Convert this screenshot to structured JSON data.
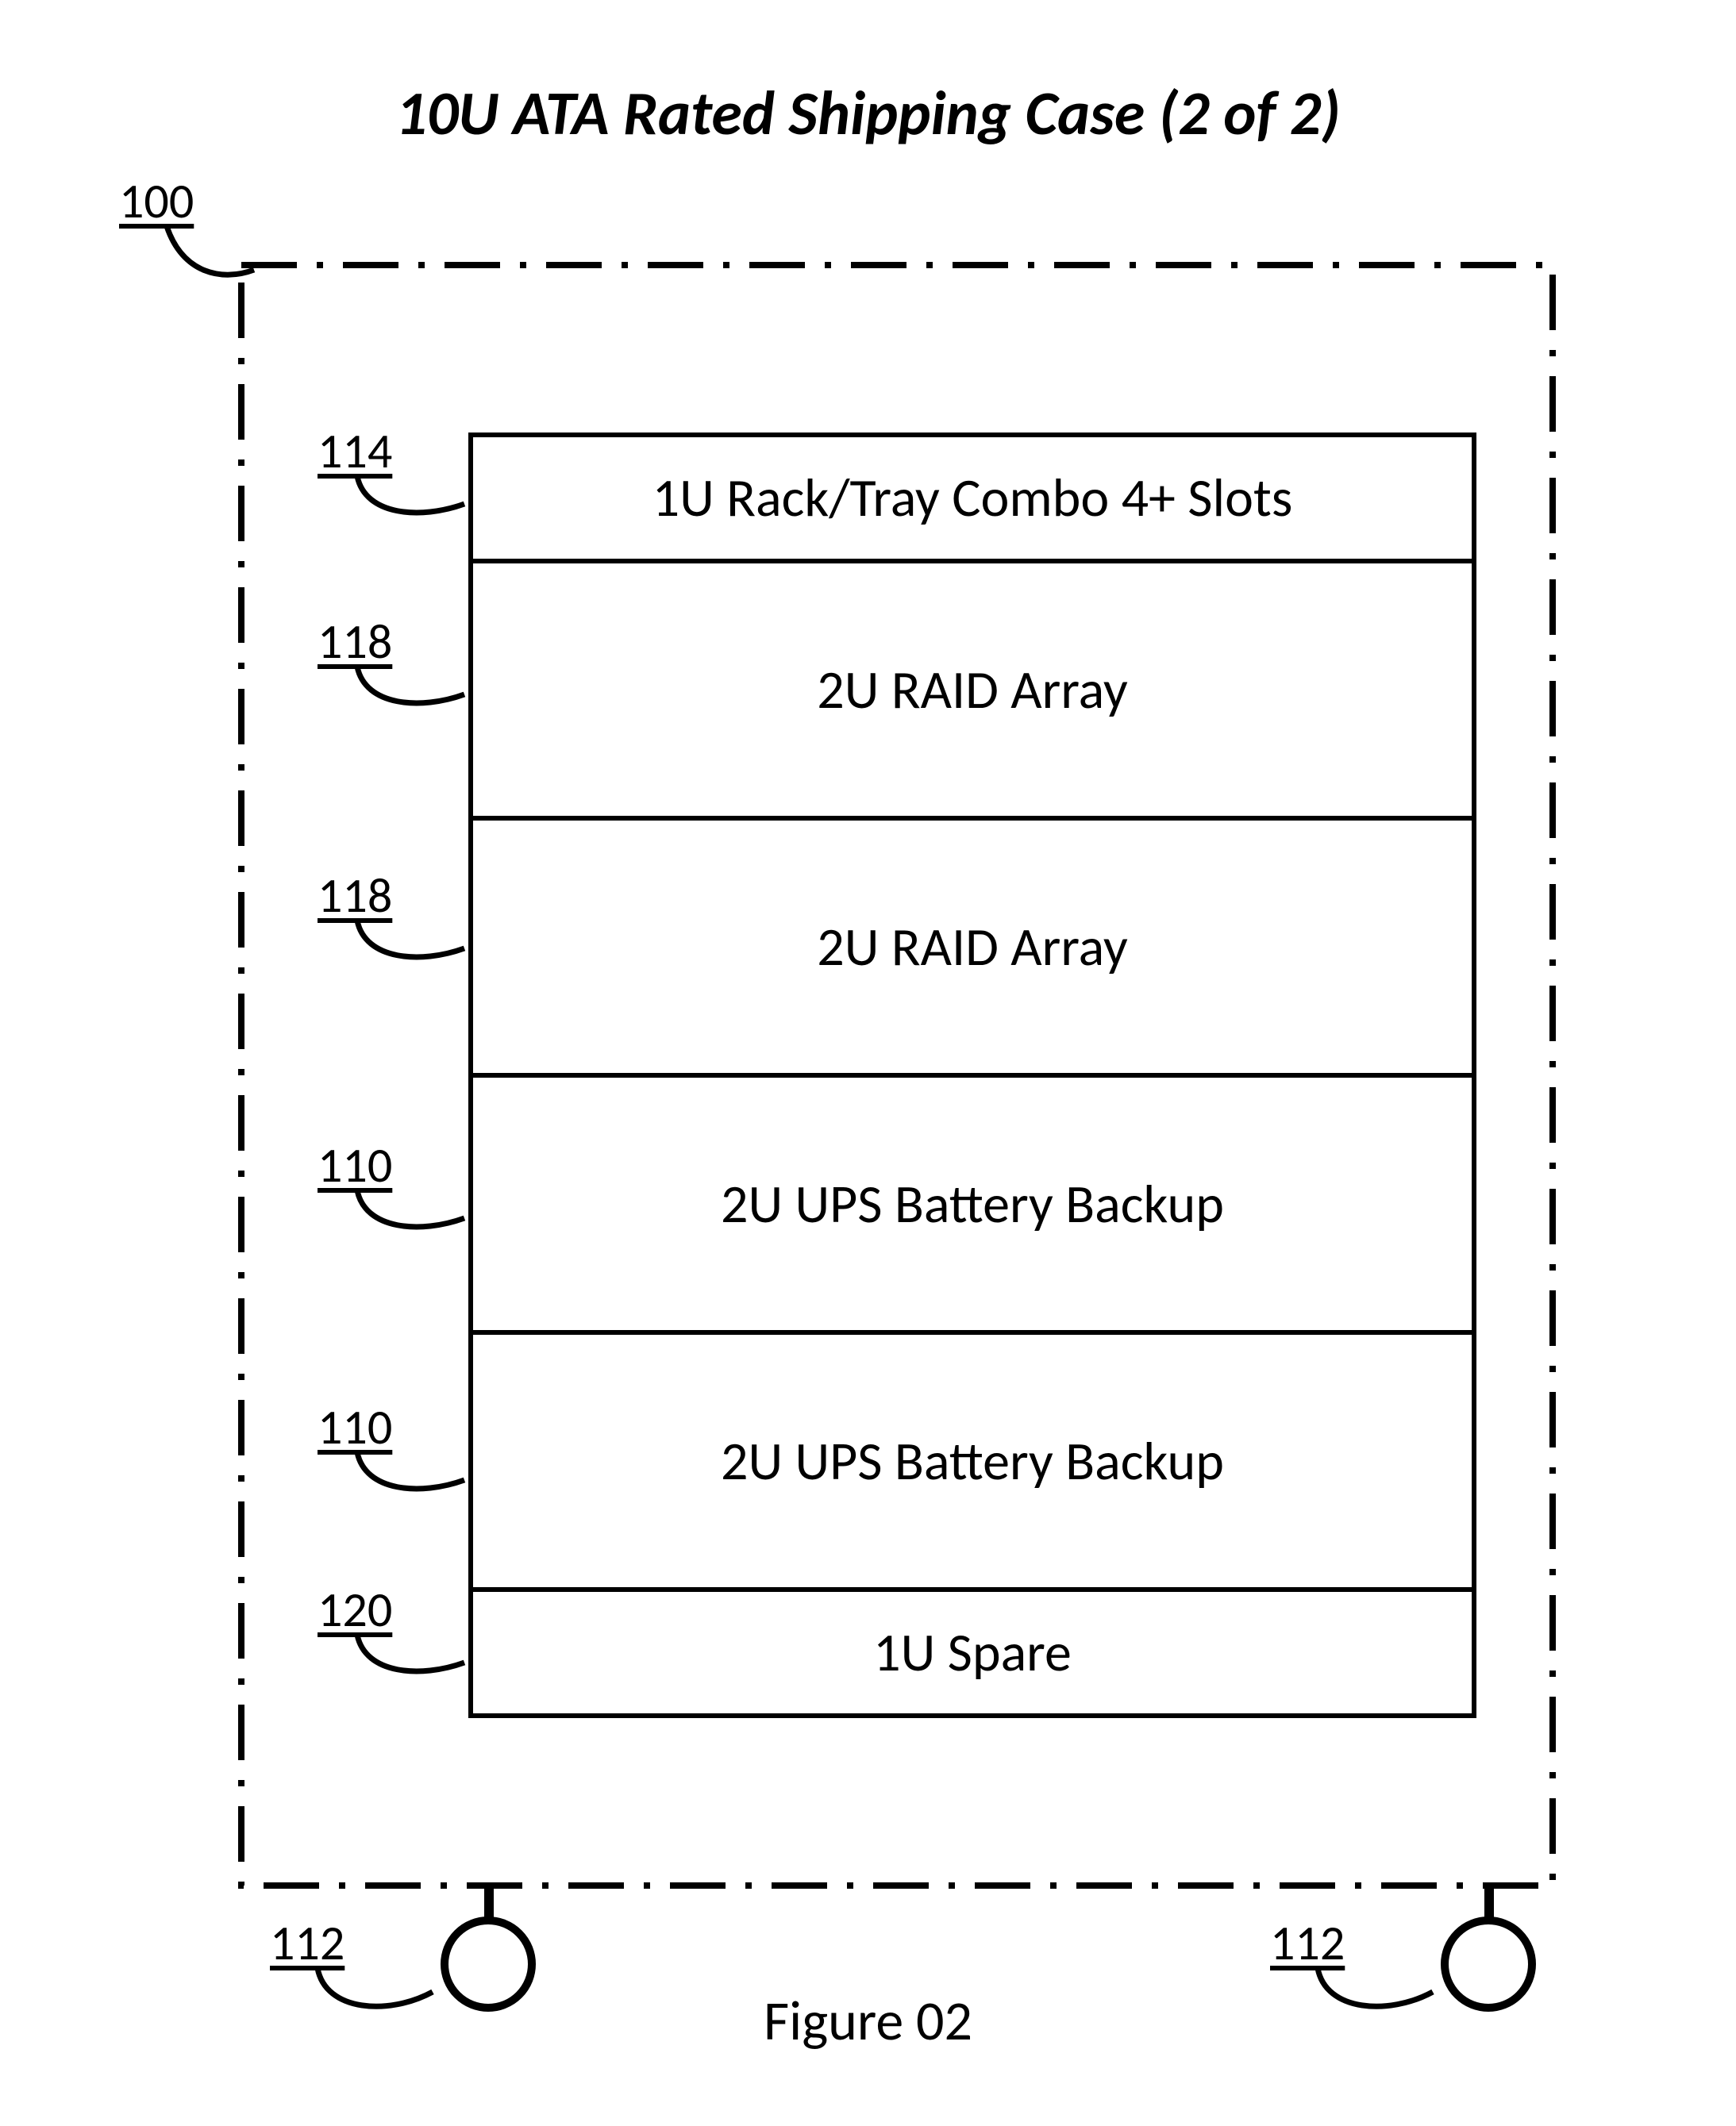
{
  "title": "10U ATA Rated Shipping Case (2 of 2)",
  "figure_caption": "Figure 02",
  "refs": {
    "case": "100",
    "wheel_left": "112",
    "wheel_right": "112",
    "slot1": "114",
    "slot2": "118",
    "slot3": "118",
    "slot4": "110",
    "slot5": "110",
    "slot6": "120"
  },
  "slots": [
    {
      "u": 1,
      "label": "1U Rack/Tray Combo 4+ Slots"
    },
    {
      "u": 2,
      "label": "2U RAID Array"
    },
    {
      "u": 2,
      "label": "2U RAID Array"
    },
    {
      "u": 2,
      "label": "2U UPS Battery Backup"
    },
    {
      "u": 2,
      "label": "2U UPS Battery Backup"
    },
    {
      "u": 1,
      "label": "1U Spare"
    }
  ]
}
